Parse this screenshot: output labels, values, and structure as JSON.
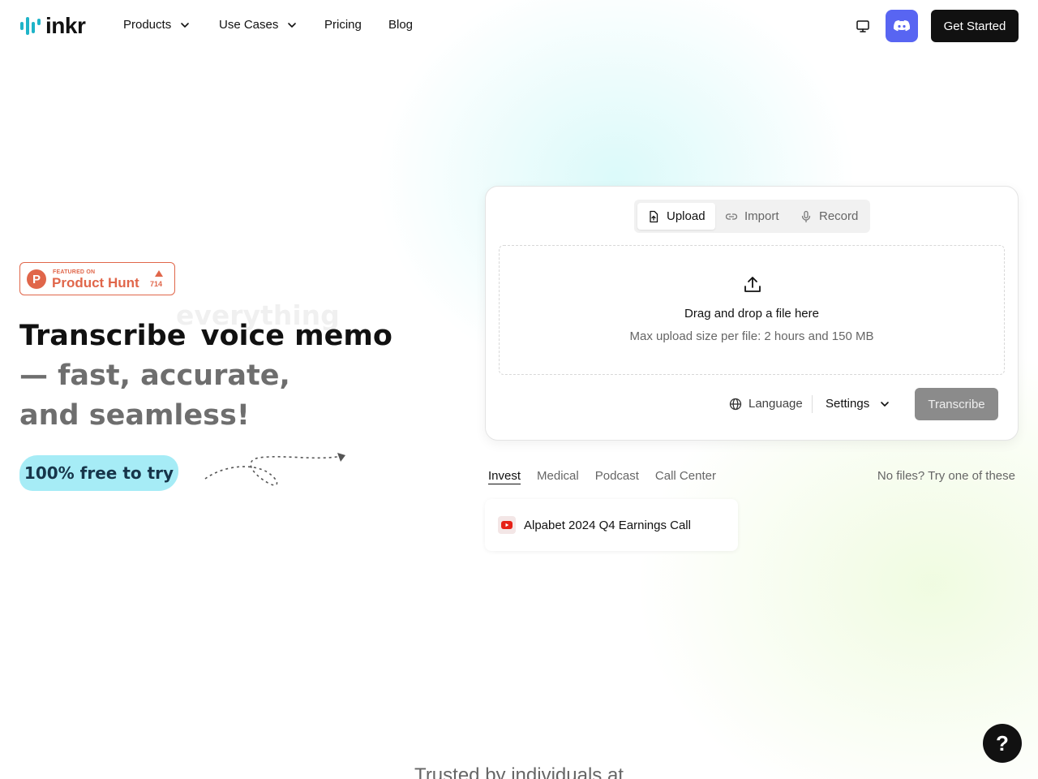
{
  "brand": {
    "name": "inkr",
    "accent": "#1fb4c8"
  },
  "nav": {
    "products": "Products",
    "use_cases": "Use Cases",
    "pricing": "Pricing",
    "blog": "Blog",
    "get_started": "Get Started",
    "discord_color": "#5865F2"
  },
  "product_hunt": {
    "featured": "FEATURED ON",
    "name": "Product Hunt",
    "count": "714",
    "color": "#e0664a"
  },
  "hero": {
    "line1": "Transcribe",
    "rotating_ghost": "everything",
    "rotating_word": "voice memo",
    "line2": "— fast, accurate,",
    "line3": "and seamless!",
    "free_pill": "100% free to try"
  },
  "upload_card": {
    "tabs": [
      {
        "label": "Upload",
        "icon": "file-upload-icon",
        "active": true
      },
      {
        "label": "Import",
        "icon": "link-icon",
        "active": false
      },
      {
        "label": "Record",
        "icon": "microphone-icon",
        "active": false
      }
    ],
    "dropzone_title": "Drag and drop a file here",
    "dropzone_subtitle": "Max upload size per file: 2 hours and 150 MB",
    "language": "Language",
    "settings": "Settings",
    "transcribe": "Transcribe"
  },
  "samples": {
    "tabs": [
      {
        "label": "Invest",
        "active": true
      },
      {
        "label": "Medical",
        "active": false
      },
      {
        "label": "Podcast",
        "active": false
      },
      {
        "label": "Call Center",
        "active": false
      }
    ],
    "hint": "No files? Try one of these",
    "items": [
      {
        "title": "Alpabet 2024 Q4 Earnings Call",
        "icon": "youtube-icon"
      }
    ]
  },
  "help_label": "?",
  "trusted_text": "Trusted by individuals at"
}
